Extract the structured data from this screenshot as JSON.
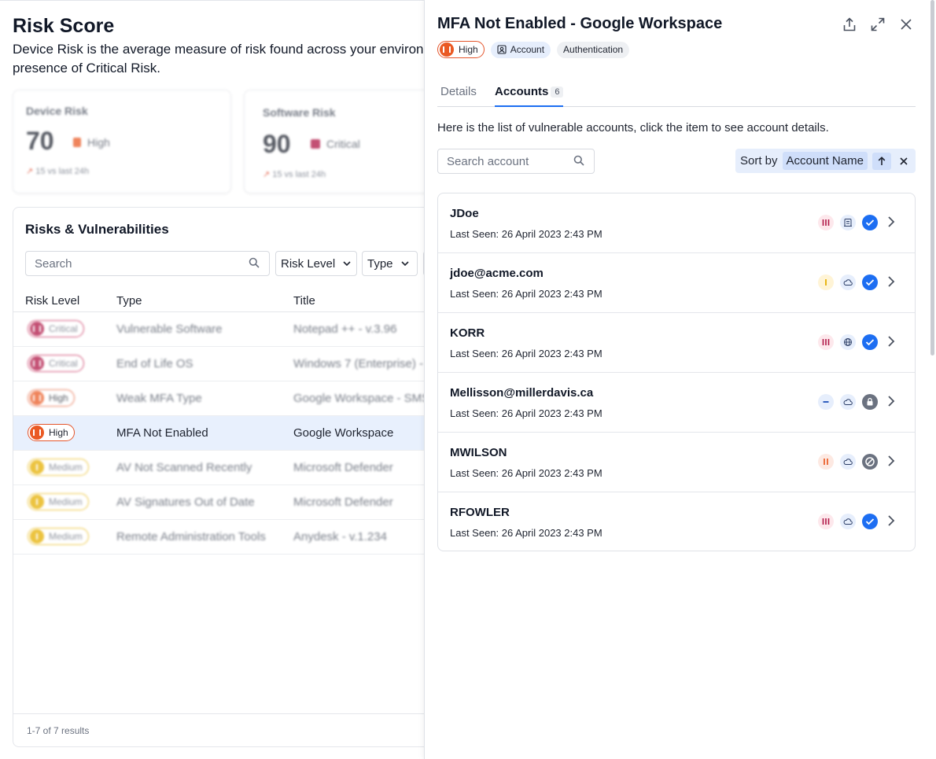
{
  "background": {
    "title": "Risk Score",
    "description": "Device Risk is the average measure of risk found across your environment and presence of Critical Risk.",
    "cards": [
      {
        "label": "Device Risk",
        "value": "70",
        "level": "High",
        "level_color": "#ea5a24",
        "delta": "15 vs last 24h"
      },
      {
        "label": "Software Risk",
        "value": "90",
        "level": "Critical",
        "level_color": "#b01646",
        "delta": "15 vs last 24h"
      }
    ],
    "table": {
      "title": "Risks & Vulnerabilities",
      "search_placeholder": "Search",
      "filters": [
        "Risk Level",
        "Type"
      ],
      "columns": [
        "Risk Level",
        "Type",
        "Title"
      ],
      "rows": [
        {
          "level": "Critical",
          "type": "Vulnerable Software",
          "title": "Notepad ++ - v.3.96"
        },
        {
          "level": "Critical",
          "type": "End of Life OS",
          "title": "Windows 7 (Enterprise) -"
        },
        {
          "level": "High",
          "type": "Weak MFA Type",
          "title": "Google Workspace - SMS"
        },
        {
          "level": "High",
          "type": "MFA Not Enabled",
          "title": "Google Workspace"
        },
        {
          "level": "Medium",
          "type": "AV Not Scanned Recently",
          "title": "Microsoft Defender"
        },
        {
          "level": "Medium",
          "type": "AV Signatures Out of Date",
          "title": "Microsoft Defender"
        },
        {
          "level": "Medium",
          "type": "Remote Administration Tools",
          "title": "Anydesk - v.1.234"
        }
      ],
      "footer": "1-7 of 7 results"
    }
  },
  "panel": {
    "title": "MFA Not Enabled - Google Workspace",
    "severity": "High",
    "chips": [
      "Account",
      "Authentication"
    ],
    "tabs": [
      {
        "label": "Details"
      },
      {
        "label": "Accounts",
        "count": "6"
      }
    ],
    "intro": "Here is the list of vulnerable accounts, click the item to see account details.",
    "search_placeholder": "Search account",
    "sort": {
      "prefix": "Sort by",
      "field": "Account Name",
      "direction": "ascending"
    },
    "accounts": [
      {
        "name": "JDoe",
        "last_seen": "Last Seen: 26 April 2023 2:43 PM",
        "level": "critical",
        "source": "directory-icon",
        "status": "verified"
      },
      {
        "name": "jdoe@acme.com",
        "last_seen": "Last Seen: 26 April 2023 2:43 PM",
        "level": "medium",
        "source": "cloud-icon",
        "status": "verified"
      },
      {
        "name": "KORR",
        "last_seen": "Last Seen: 26 April 2023 2:43 PM",
        "level": "critical",
        "source": "globe-icon",
        "status": "verified"
      },
      {
        "name": "Mellisson@millerdavis.ca",
        "last_seen": "Last Seen: 26 April 2023 2:43 PM",
        "level": "low",
        "source": "cloud-icon",
        "status": "locked"
      },
      {
        "name": "MWILSON",
        "last_seen": "Last Seen: 26 April 2023 2:43 PM",
        "level": "high",
        "source": "cloud-icon",
        "status": "disabled"
      },
      {
        "name": "RFOWLER",
        "last_seen": "Last Seen: 26 April 2023 2:43 PM",
        "level": "critical",
        "source": "cloud-icon",
        "status": "verified"
      }
    ]
  },
  "colors": {
    "accent": "#1d6ef2",
    "critical": "#b01646",
    "high": "#ea5a24",
    "medium": "#e6b000"
  }
}
